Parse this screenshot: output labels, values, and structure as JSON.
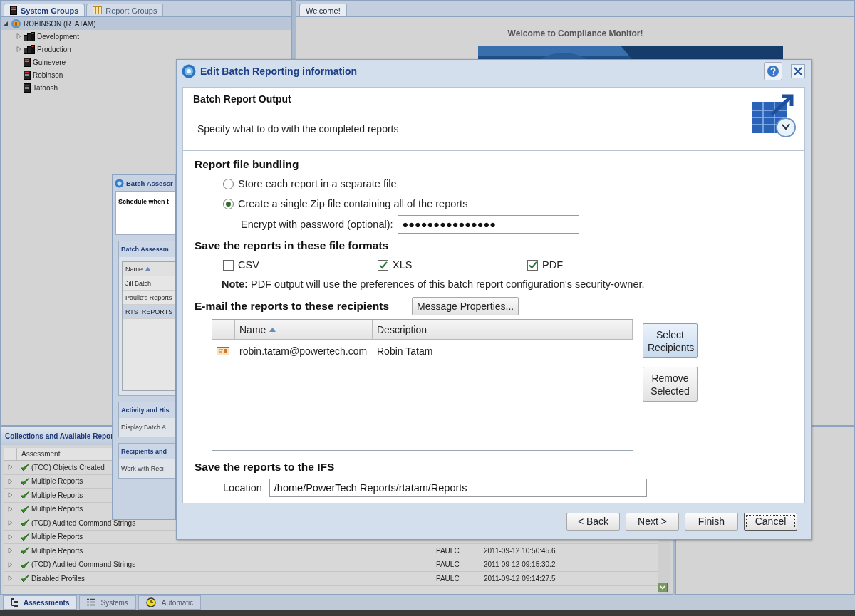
{
  "left_panel": {
    "tabs": [
      {
        "label": "System Groups",
        "selected": true,
        "kind": "system"
      },
      {
        "label": "Report Groups",
        "selected": false,
        "kind": "grid"
      }
    ],
    "tree": [
      {
        "label": "ROBINSON (RTATAM)",
        "kind": "root",
        "expanded": true,
        "children": [
          {
            "label": "Development",
            "kind": "group",
            "expanded": false
          },
          {
            "label": "Production",
            "kind": "group",
            "expanded": false
          },
          {
            "label": "Guinevere",
            "kind": "system"
          },
          {
            "label": "Robinson",
            "kind": "system"
          },
          {
            "label": "Tatoosh",
            "kind": "system"
          }
        ]
      }
    ]
  },
  "welcome_panel": {
    "tabs": [
      {
        "label": "Welcome!",
        "selected": true
      }
    ],
    "heading": "Welcome to Compliance Monitor!"
  },
  "collections_panel": {
    "title": "Collections and Available Repor",
    "columns": [
      "Assessment"
    ],
    "rows": [
      {
        "name": "(TCO) Objects Created"
      },
      {
        "name": "Multiple Reports"
      },
      {
        "name": "Multiple Reports"
      },
      {
        "name": "Multiple Reports"
      },
      {
        "name": "(TCD) Audited Command Strings"
      },
      {
        "name": "Multiple Reports"
      },
      {
        "name": "Multiple Reports",
        "user": "PAULC",
        "date": "2011-09-12 10:50:45.6"
      },
      {
        "name": "(TCD) Audited Command Strings",
        "user": "PAULC",
        "date": "2011-09-12 09:15:30.2"
      },
      {
        "name": "Disabled Profiles",
        "user": "PAULC",
        "date": "2011-09-12 09:14:27.5"
      }
    ]
  },
  "bottom_tabs": [
    {
      "label": "Assessments",
      "selected": true,
      "kind": "tree"
    },
    {
      "label": "Systems",
      "selected": false,
      "kind": "list"
    },
    {
      "label": "Automatic",
      "selected": false,
      "kind": "clock"
    }
  ],
  "batch_dialog": {
    "title": "Batch Assessr",
    "intro": "Schedule when t",
    "list_title": "Batch Assessm",
    "column": {
      "label": "Name",
      "sorted": true
    },
    "rows": [
      {
        "name": "Jill Batch",
        "selected": false
      },
      {
        "name": "Paulie's Reports",
        "selected": false
      },
      {
        "name": "RTS_REPORTS",
        "selected": true
      }
    ],
    "sections": [
      {
        "title": "Activity and His",
        "text": "Display Batch A"
      },
      {
        "title": "Recipients and",
        "text": "Work with Reci"
      }
    ]
  },
  "dialog": {
    "title": "Edit Batch Reporting information",
    "header": {
      "title": "Batch Report Output",
      "subtitle": "Specify what to do with the completed reports"
    },
    "bundling": {
      "heading": "Report file bundling",
      "options": [
        {
          "label": "Store each report in a separate file",
          "selected": false
        },
        {
          "label": "Create a single Zip file containing all of the reports",
          "selected": true
        }
      ],
      "password_label": "Encrypt with password (optional):",
      "password": "●●●●●●●●●●●●●●●"
    },
    "formats": {
      "heading": "Save the reports in these file formats",
      "items": [
        {
          "label": "CSV",
          "checked": false
        },
        {
          "label": "XLS",
          "checked": true
        },
        {
          "label": "PDF",
          "checked": true
        }
      ],
      "note": "**Note:** PDF output will use the preferences of this batch report configuration's security-owner."
    },
    "email": {
      "heading": "E-mail the reports to these recipients",
      "properties_button": "Message Properties...",
      "columns": [
        {
          "label": "Name",
          "sorted": true
        },
        {
          "label": "Description",
          "sorted": false
        }
      ],
      "rows": [
        {
          "name": "robin.tatam@powertech.com",
          "description": "Robin Tatam"
        }
      ],
      "buttons": [
        "Select Recipients",
        "Remove Selected"
      ]
    },
    "ifs": {
      "heading": "Save the reports to the IFS",
      "location_label": "Location",
      "location": "/home/PowerTech Reports/rtatam/Reports"
    },
    "buttons": [
      {
        "label": "< Back",
        "focused": false
      },
      {
        "label": "Next >",
        "focused": false
      },
      {
        "label": "Finish",
        "focused": false
      },
      {
        "label": "Cancel",
        "focused": true
      }
    ]
  }
}
